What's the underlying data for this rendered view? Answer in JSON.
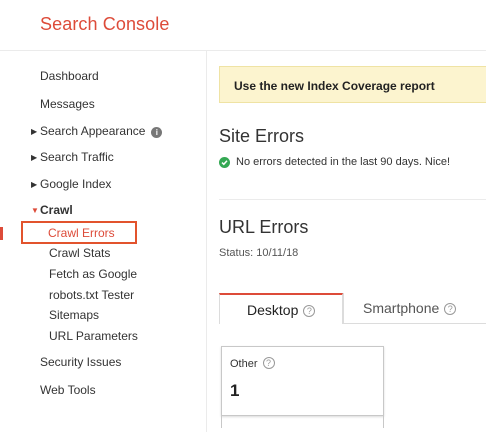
{
  "app": {
    "title": "Search Console"
  },
  "sidebar": {
    "dashboard": "Dashboard",
    "messages": "Messages",
    "search_appearance": "Search Appearance",
    "search_traffic": "Search Traffic",
    "google_index": "Google Index",
    "crawl": "Crawl",
    "crawl_items": [
      "Crawl Errors",
      "Crawl Stats",
      "Fetch as Google",
      "robots.txt Tester",
      "Sitemaps",
      "URL Parameters"
    ],
    "security_issues": "Security Issues",
    "web_tools": "Web Tools",
    "selected": "Crawl Errors"
  },
  "main": {
    "banner": "Use the new Index Coverage report",
    "site_errors": {
      "title": "Site Errors",
      "status": "No errors detected in the last 90 days. Nice!"
    },
    "url_errors": {
      "title": "URL Errors",
      "status": "Status: 10/11/18"
    },
    "tabs": [
      {
        "label": "Desktop",
        "active": true
      },
      {
        "label": "Smartphone",
        "active": false
      }
    ],
    "card": {
      "label": "Other",
      "value": "1"
    }
  },
  "icons": {
    "info": "info-icon",
    "check": "check-circle-icon",
    "help": "help-icon",
    "arrow_right": "triangle-right-icon",
    "arrow_down": "triangle-down-icon"
  },
  "colors": {
    "brand_red": "#dd4b39",
    "selection_border": "#e2532d",
    "banner_bg": "#fcf4cf",
    "success_green": "#34a853"
  }
}
